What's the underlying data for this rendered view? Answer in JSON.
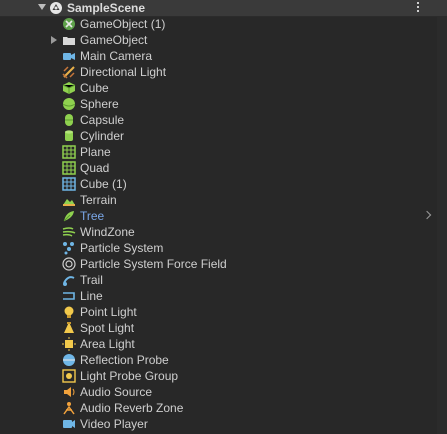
{
  "scene": {
    "name": "SampleScene",
    "icon": "unity-icon"
  },
  "items": [
    {
      "label": "GameObject (1)",
      "icon": "gameobject-green-icon"
    },
    {
      "label": "GameObject",
      "icon": "folder-icon",
      "expandable": true
    },
    {
      "label": "Main Camera",
      "icon": "camera-icon"
    },
    {
      "label": "Directional Light",
      "icon": "directional-light-icon"
    },
    {
      "label": "Cube",
      "icon": "cube-icon"
    },
    {
      "label": "Sphere",
      "icon": "sphere-icon"
    },
    {
      "label": "Capsule",
      "icon": "capsule-icon"
    },
    {
      "label": "Cylinder",
      "icon": "cylinder-icon"
    },
    {
      "label": "Plane",
      "icon": "plane-icon"
    },
    {
      "label": "Quad",
      "icon": "quad-icon"
    },
    {
      "label": "Cube (1)",
      "icon": "cube-grid-icon"
    },
    {
      "label": "Terrain",
      "icon": "terrain-icon"
    },
    {
      "label": "Tree",
      "icon": "tree-icon",
      "prefab": true
    },
    {
      "label": "WindZone",
      "icon": "windzone-icon"
    },
    {
      "label": "Particle System",
      "icon": "particle-system-icon"
    },
    {
      "label": "Particle System Force Field",
      "icon": "force-field-icon"
    },
    {
      "label": "Trail",
      "icon": "trail-icon"
    },
    {
      "label": "Line",
      "icon": "line-icon"
    },
    {
      "label": "Point Light",
      "icon": "point-light-icon"
    },
    {
      "label": "Spot Light",
      "icon": "spot-light-icon"
    },
    {
      "label": "Area Light",
      "icon": "area-light-icon"
    },
    {
      "label": "Reflection Probe",
      "icon": "reflection-probe-icon"
    },
    {
      "label": "Light Probe Group",
      "icon": "light-probe-group-icon"
    },
    {
      "label": "Audio Source",
      "icon": "audio-source-icon"
    },
    {
      "label": "Audio Reverb Zone",
      "icon": "audio-reverb-zone-icon"
    },
    {
      "label": "Video Player",
      "icon": "video-player-icon"
    }
  ],
  "colors": {
    "background": "#282828",
    "scene_row": "#3a3a3a",
    "prefab_text": "#7aa7e8",
    "text": "#cfcfcf"
  }
}
